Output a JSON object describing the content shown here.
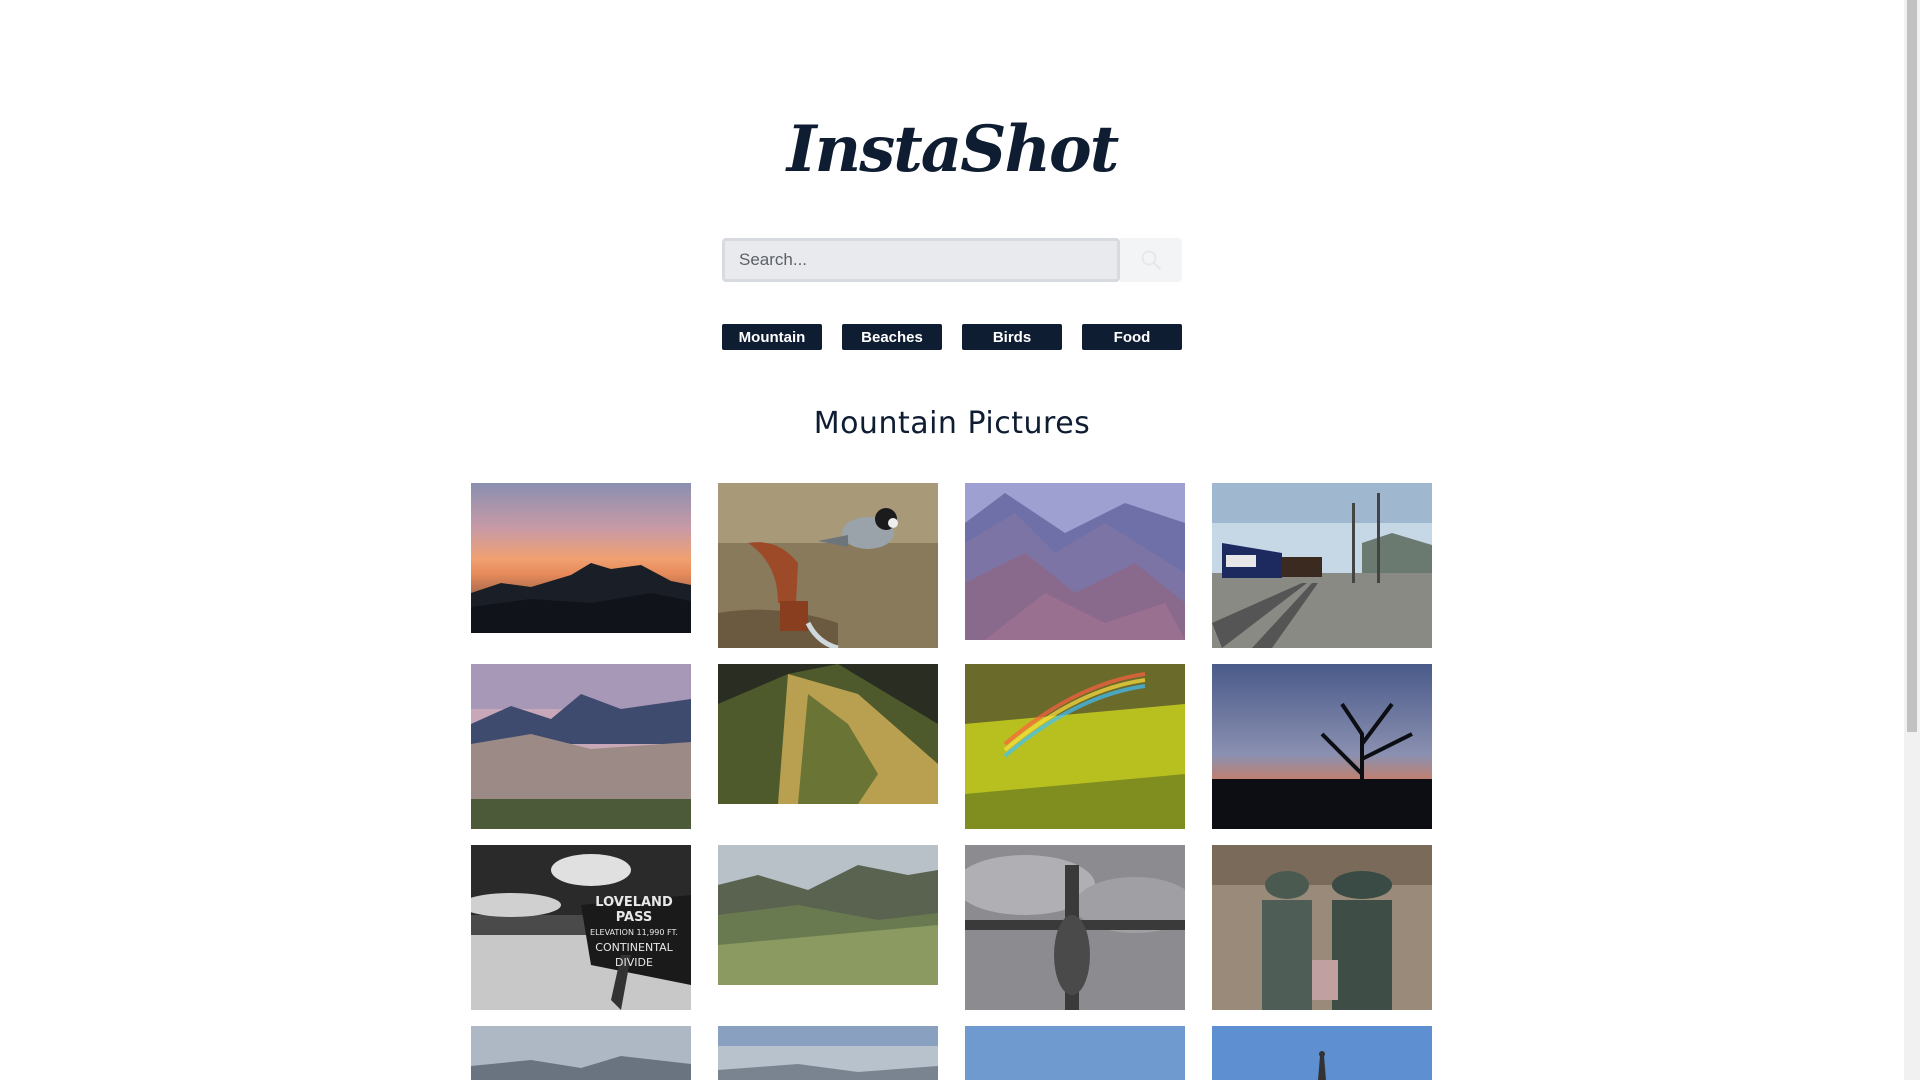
{
  "header": {
    "logo": "InstaShot"
  },
  "search": {
    "placeholder": "Search...",
    "icon": "search-icon"
  },
  "categories": [
    {
      "label": "Mountain"
    },
    {
      "label": "Beaches"
    },
    {
      "label": "Birds"
    },
    {
      "label": "Food"
    }
  ],
  "gallery": {
    "title": "Mountain Pictures",
    "columns": 4,
    "photos": [
      {
        "name": "photo-sunset-silhouette"
      },
      {
        "name": "photo-chickadee-on-spout"
      },
      {
        "name": "photo-purple-mountain-ridges"
      },
      {
        "name": "photo-train-on-tracks"
      },
      {
        "name": "photo-sand-dunes-mountains"
      },
      {
        "name": "photo-green-ridge-slope"
      },
      {
        "name": "photo-rainbow-yellow-hillside"
      },
      {
        "name": "photo-dead-tree-dusk"
      },
      {
        "name": "photo-loveland-pass-sign"
      },
      {
        "name": "photo-alpine-valley-meadow"
      },
      {
        "name": "photo-crucifix-statue"
      },
      {
        "name": "photo-bronze-couple-statue"
      },
      {
        "name": "photo-distant-mountain-range"
      },
      {
        "name": "photo-cloudy-peaks"
      },
      {
        "name": "photo-blue-sky"
      },
      {
        "name": "photo-blue-sky-spire"
      }
    ],
    "sign_text": [
      "LOVELAND PASS",
      "ELEVATION 11,990 FT.",
      "CONTINENTAL",
      "DIVIDE"
    ]
  },
  "colors": {
    "navy": "#0f1d33",
    "background": "#ffffff",
    "search_bg": "#e8eaed"
  }
}
